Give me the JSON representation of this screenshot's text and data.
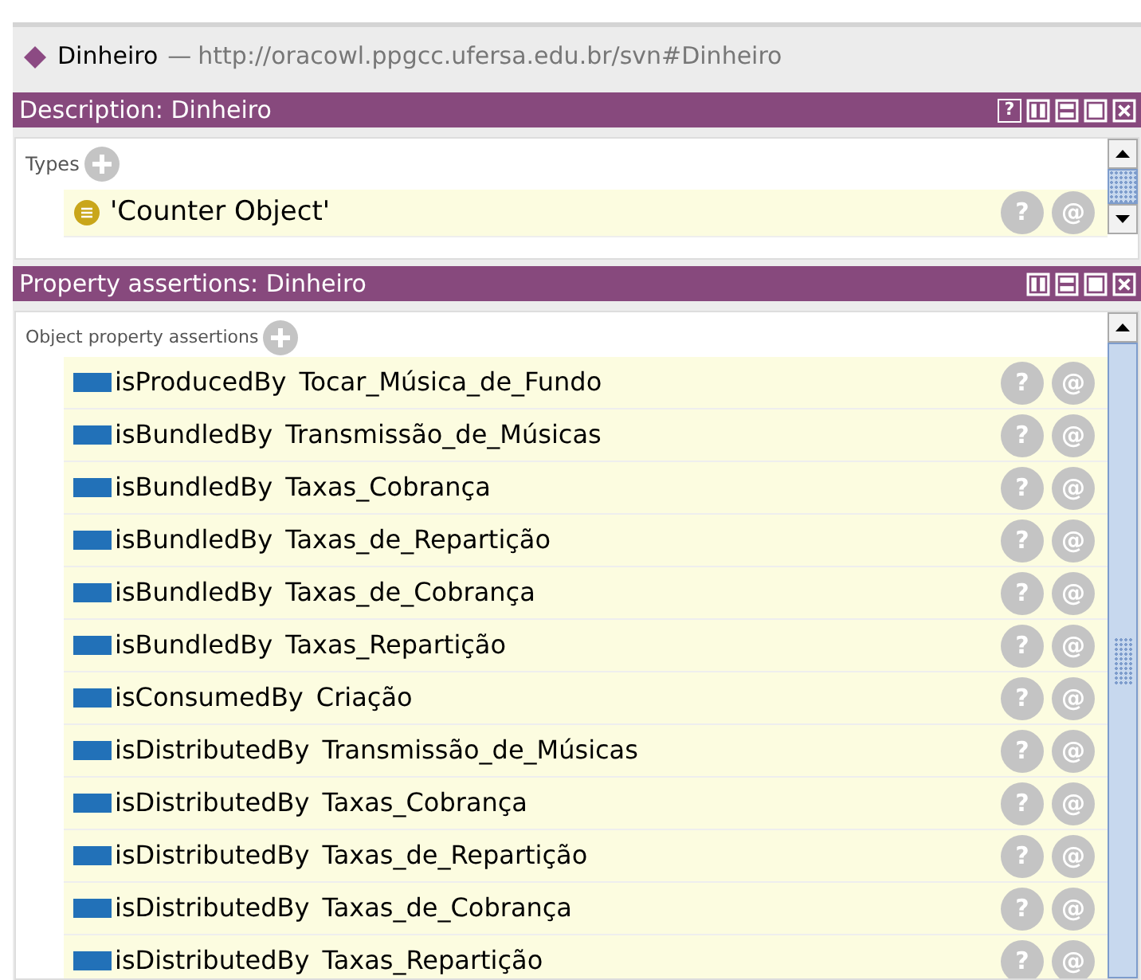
{
  "entity": {
    "name": "Dinheiro",
    "separator": "—",
    "iri": "http://oracowl.ppgcc.ufersa.edu.br/svn#Dinheiro"
  },
  "panels": [
    {
      "title": "Description: Dinheiro",
      "buttons": [
        {
          "kind": "help",
          "label": "?"
        },
        {
          "kind": "columns"
        },
        {
          "kind": "rows"
        },
        {
          "kind": "maximize"
        },
        {
          "kind": "close"
        }
      ],
      "section": "Types",
      "rows": [
        {
          "kind": "class",
          "text": "'Counter Object'",
          "help": "?",
          "annotate": "@"
        }
      ]
    },
    {
      "title": "Property assertions: Dinheiro",
      "buttons": [
        {
          "kind": "columns"
        },
        {
          "kind": "rows"
        },
        {
          "kind": "maximize"
        },
        {
          "kind": "close"
        }
      ],
      "section": "Object property assertions",
      "rows": [
        {
          "kind": "object",
          "property": "isProducedBy",
          "value": "Tocar_Música_de_Fundo",
          "help": "?",
          "annotate": "@"
        },
        {
          "kind": "object",
          "property": "isBundledBy",
          "value": "Transmissão_de_Músicas",
          "help": "?",
          "annotate": "@"
        },
        {
          "kind": "object",
          "property": "isBundledBy",
          "value": "Taxas_Cobrança",
          "help": "?",
          "annotate": "@"
        },
        {
          "kind": "object",
          "property": "isBundledBy",
          "value": "Taxas_de_Repartição",
          "help": "?",
          "annotate": "@"
        },
        {
          "kind": "object",
          "property": "isBundledBy",
          "value": "Taxas_de_Cobrança",
          "help": "?",
          "annotate": "@"
        },
        {
          "kind": "object",
          "property": "isBundledBy",
          "value": "Taxas_Repartição",
          "help": "?",
          "annotate": "@"
        },
        {
          "kind": "object",
          "property": "isConsumedBy",
          "value": "Criação",
          "help": "?",
          "annotate": "@"
        },
        {
          "kind": "object",
          "property": "isDistributedBy",
          "value": "Transmissão_de_Músicas",
          "help": "?",
          "annotate": "@"
        },
        {
          "kind": "object",
          "property": "isDistributedBy",
          "value": "Taxas_Cobrança",
          "help": "?",
          "annotate": "@"
        },
        {
          "kind": "object",
          "property": "isDistributedBy",
          "value": "Taxas_de_Repartição",
          "help": "?",
          "annotate": "@"
        },
        {
          "kind": "object",
          "property": "isDistributedBy",
          "value": "Taxas_de_Cobrança",
          "help": "?",
          "annotate": "@"
        },
        {
          "kind": "object",
          "property": "isDistributedBy",
          "value": "Taxas_Repartição",
          "help": "?",
          "annotate": "@"
        }
      ]
    }
  ]
}
